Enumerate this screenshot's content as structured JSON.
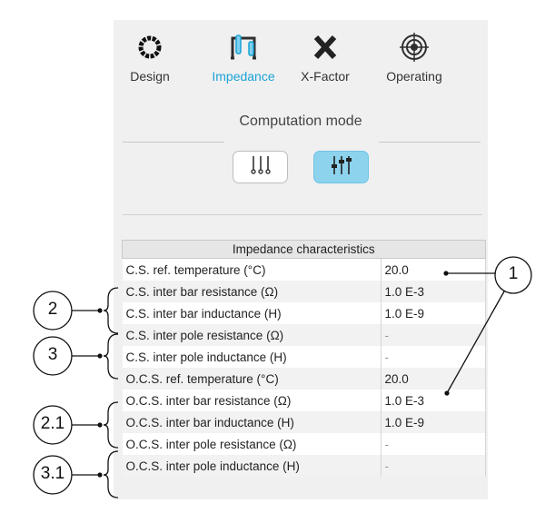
{
  "tabs": [
    {
      "label": "Design",
      "icon": "design-ring-icon",
      "active": false
    },
    {
      "label": "Impedance",
      "icon": "impedance-coil-icon",
      "active": true
    },
    {
      "label": "X-Factor",
      "icon": "x-factor-icon",
      "active": false
    },
    {
      "label": "Operating",
      "icon": "operating-target-icon",
      "active": false
    }
  ],
  "computation_mode": {
    "title": "Computation mode",
    "buttons": [
      {
        "icon": "simple-sliders-icon",
        "active": false
      },
      {
        "icon": "advanced-sliders-icon",
        "active": true
      }
    ]
  },
  "table": {
    "title": "Impedance characteristics",
    "rows": [
      {
        "name": "C.S. ref. temperature (°C)",
        "value": "20.0"
      },
      {
        "name": "C.S. inter bar resistance (Ω)",
        "value": "1.0 E-3"
      },
      {
        "name": "C.S. inter bar inductance (H)",
        "value": "1.0 E-9"
      },
      {
        "name": "C.S. inter pole resistance (Ω)",
        "value": "-"
      },
      {
        "name": "C.S. inter pole inductance (H)",
        "value": "-"
      },
      {
        "name": "O.C.S. ref. temperature (°C)",
        "value": "20.0"
      },
      {
        "name": "O.C.S. inter bar resistance (Ω)",
        "value": "1.0 E-3"
      },
      {
        "name": "O.C.S. inter bar inductance (H)",
        "value": "1.0 E-9"
      },
      {
        "name": "O.C.S. inter pole resistance (Ω)",
        "value": "-"
      },
      {
        "name": "O.C.S. inter pole inductance (H)",
        "value": "-"
      }
    ]
  },
  "callouts": {
    "c1": "1",
    "c2": "2",
    "c3": "3",
    "c21": "2.1",
    "c31": "3.1"
  },
  "colors": {
    "accent": "#1ba3d6",
    "active_button": "#8dd3ee",
    "panel": "#f0f0f0"
  }
}
